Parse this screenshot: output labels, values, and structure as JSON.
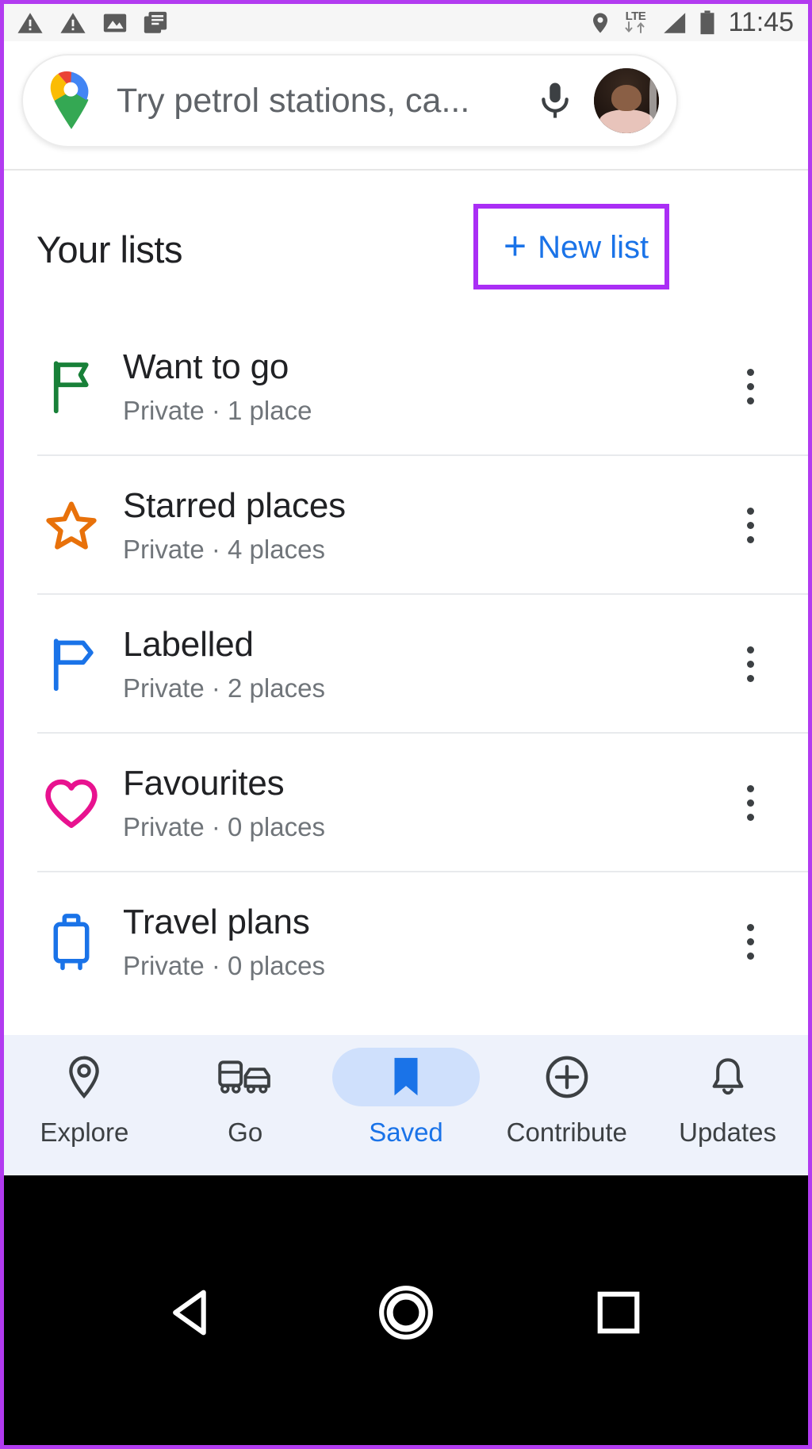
{
  "status_bar": {
    "icons_left": [
      "warning-triangle-icon",
      "warning-triangle-icon",
      "image-icon",
      "document-stack-icon"
    ],
    "icons_right": [
      "location-pin-icon",
      "lte-icon",
      "signal-icon",
      "battery-icon"
    ],
    "network_label": "LTE",
    "clock": "11:45"
  },
  "search": {
    "logo": "google-maps-logo",
    "placeholder": "Try petrol stations, ca...",
    "mic_icon": "microphone-icon",
    "avatar": "account-avatar"
  },
  "header": {
    "title": "Your lists",
    "new_list": {
      "plus": "+",
      "label": "New list",
      "color": "#1a73e8"
    }
  },
  "lists": [
    {
      "icon": "flag-icon",
      "icon_color": "#188038",
      "title": "Want to go",
      "subtitle": "Private · 1 place",
      "menu": "more-options-icon"
    },
    {
      "icon": "star-icon",
      "icon_color": "#e8710a",
      "title": "Starred places",
      "subtitle": "Private · 4 places",
      "menu": "more-options-icon"
    },
    {
      "icon": "label-flag-icon",
      "icon_color": "#1a73e8",
      "title": "Labelled",
      "subtitle": "Private · 2 places",
      "menu": "more-options-icon"
    },
    {
      "icon": "heart-icon",
      "icon_color": "#e8128f",
      "title": "Favourites",
      "subtitle": "Private · 0 places",
      "menu": "more-options-icon"
    },
    {
      "icon": "suitcase-icon",
      "icon_color": "#1a73e8",
      "title": "Travel plans",
      "subtitle": "Private · 0 places",
      "menu": "more-options-icon"
    }
  ],
  "bottom_nav": {
    "active_index": 2,
    "items": [
      {
        "icon": "location-pin-icon",
        "label": "Explore"
      },
      {
        "icon": "transit-car-icon",
        "label": "Go"
      },
      {
        "icon": "bookmark-icon",
        "label": "Saved"
      },
      {
        "icon": "plus-circle-icon",
        "label": "Contribute"
      },
      {
        "icon": "bell-icon",
        "label": "Updates"
      }
    ]
  },
  "system_bar": {
    "back": "back-triangle-icon",
    "home": "home-circle-icon",
    "recents": "recents-square-icon"
  },
  "annotation": {
    "highlight_color": "#aa2ef5",
    "target": "new-list-button"
  }
}
